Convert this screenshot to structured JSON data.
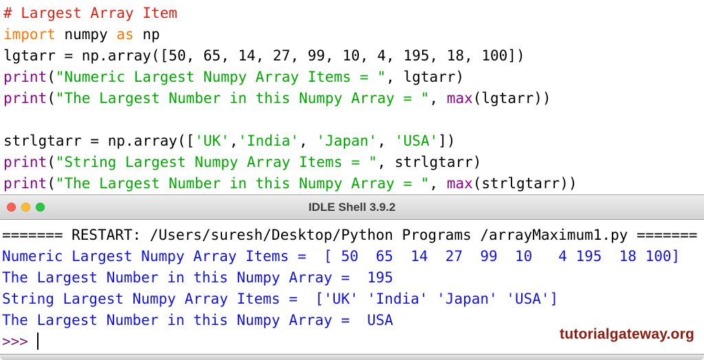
{
  "colors": {
    "plain": "#000000",
    "comment": "#dd2116",
    "keyword": "#ff7700",
    "builtin": "#900090",
    "string": "#00aa00",
    "stdout": "#1111e0",
    "restart": "#000000",
    "prompt": "#7a1f7a",
    "watermark": "#8e1a0f",
    "close": "#ff5f57",
    "minimize": "#febc2e",
    "zoom": "#28c840"
  },
  "editor": {
    "lines": [
      [
        {
          "t": "# Largest Array Item",
          "c": "comment"
        }
      ],
      [
        {
          "t": "import",
          "c": "keyword"
        },
        {
          "t": " numpy ",
          "c": "plain"
        },
        {
          "t": "as",
          "c": "keyword"
        },
        {
          "t": " np",
          "c": "plain"
        }
      ],
      [
        {
          "t": "lgtarr = np.array([50, 65, 14, 27, 99, 10, 4, 195, 18, 100])",
          "c": "plain"
        }
      ],
      [
        {
          "t": "print",
          "c": "builtin"
        },
        {
          "t": "(",
          "c": "plain"
        },
        {
          "t": "\"Numeric Largest Numpy Array Items = \"",
          "c": "string"
        },
        {
          "t": ", lgtarr)",
          "c": "plain"
        }
      ],
      [
        {
          "t": "print",
          "c": "builtin"
        },
        {
          "t": "(",
          "c": "plain"
        },
        {
          "t": "\"The Largest Number in this Numpy Array = \"",
          "c": "string"
        },
        {
          "t": ", ",
          "c": "plain"
        },
        {
          "t": "max",
          "c": "builtin"
        },
        {
          "t": "(lgtarr))",
          "c": "plain"
        }
      ],
      [],
      [
        {
          "t": "strlgtarr = np.array([",
          "c": "plain"
        },
        {
          "t": "'UK'",
          "c": "string"
        },
        {
          "t": ",",
          "c": "plain"
        },
        {
          "t": "'India'",
          "c": "string"
        },
        {
          "t": ", ",
          "c": "plain"
        },
        {
          "t": "'Japan'",
          "c": "string"
        },
        {
          "t": ", ",
          "c": "plain"
        },
        {
          "t": "'USA'",
          "c": "string"
        },
        {
          "t": "])",
          "c": "plain"
        }
      ],
      [
        {
          "t": "print",
          "c": "builtin"
        },
        {
          "t": "(",
          "c": "plain"
        },
        {
          "t": "\"String Largest Numpy Array Items = \"",
          "c": "string"
        },
        {
          "t": ", strlgtarr)",
          "c": "plain"
        }
      ],
      [
        {
          "t": "print",
          "c": "builtin"
        },
        {
          "t": "(",
          "c": "plain"
        },
        {
          "t": "\"The Largest Number in this Numpy Array = \"",
          "c": "string"
        },
        {
          "t": ", ",
          "c": "plain"
        },
        {
          "t": "max",
          "c": "builtin"
        },
        {
          "t": "(strlgtarr))",
          "c": "plain"
        }
      ]
    ]
  },
  "titlebar": {
    "title": "IDLE Shell 3.9.2"
  },
  "shell": {
    "lines": [
      [
        {
          "t": "======= RESTART: /Users/suresh/Desktop/Python Programs /arrayMaximum1.py =======",
          "c": "restart"
        }
      ],
      [
        {
          "t": "Numeric Largest Numpy Array Items =  [ 50  65  14  27  99  10   4 195  18 100]",
          "c": "stdout"
        }
      ],
      [
        {
          "t": "The Largest Number in this Numpy Array =  195",
          "c": "stdout"
        }
      ],
      [
        {
          "t": "String Largest Numpy Array Items =  ['UK' 'India' 'Japan' 'USA']",
          "c": "stdout"
        }
      ],
      [
        {
          "t": "The Largest Number in this Numpy Array =  USA",
          "c": "stdout"
        }
      ],
      [
        {
          "t": ">>> ",
          "c": "prompt"
        },
        {
          "t": "",
          "c": "cursor"
        }
      ]
    ]
  },
  "watermark": "tutorialgateway.org"
}
